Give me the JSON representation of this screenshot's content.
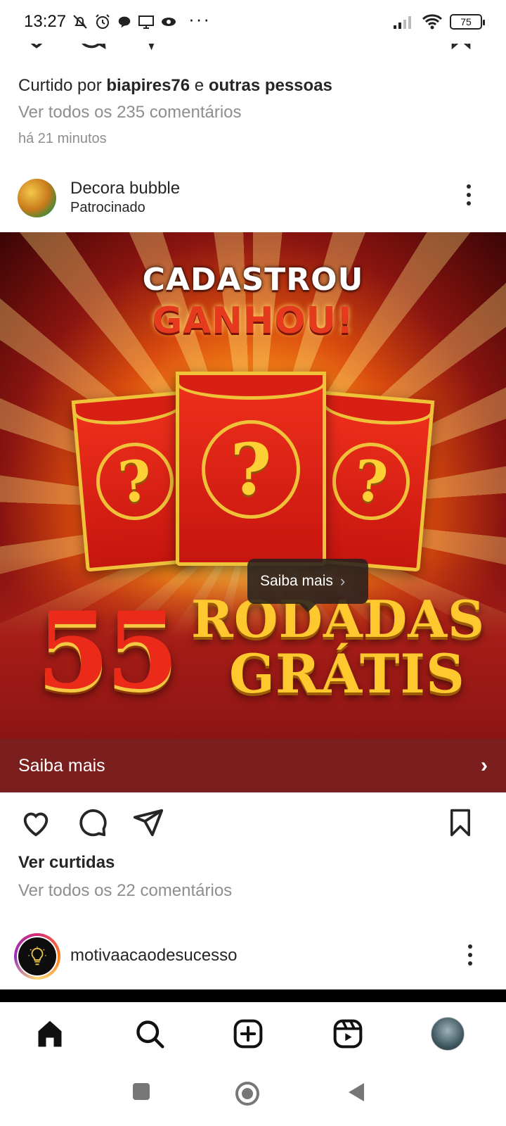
{
  "status_bar": {
    "time": "13:27",
    "more": "···",
    "battery": "75"
  },
  "previous_post": {
    "likes_prefix": "Curtido por ",
    "likes_user": "biapires76",
    "likes_mid": " e ",
    "likes_others": "outras pessoas",
    "comments_link": "Ver todos os 235 comentários",
    "time_ago": "há 21 minutos"
  },
  "sponsored_post": {
    "username": "Decora bubble",
    "sponsored_label": "Patrocinado",
    "ad": {
      "headline_line1": "CADASTROU",
      "headline_line2": "GANHOU!",
      "number": "55",
      "word1": "RODADAS",
      "word2": "GRÁTIS",
      "question_mark": "?",
      "tooltip_label": "Saiba mais",
      "tooltip_chevron": "›"
    },
    "cta_label": "Saiba mais",
    "cta_chevron": "›",
    "view_likes": "Ver curtidas",
    "comments_link": "Ver todos os 22 comentários"
  },
  "next_post": {
    "username": "motivaacaodesucesso"
  },
  "colors": {
    "cta_bar": "#7a1f1d",
    "secondary_text": "#8e8e8e",
    "primary_text": "#262626"
  },
  "icons": {
    "nav": [
      "home-icon",
      "search-icon",
      "create-icon",
      "reels-icon",
      "profile-avatar"
    ],
    "post_actions": [
      "heart-icon",
      "comment-icon",
      "share-icon",
      "bookmark-icon"
    ],
    "system": [
      "recents-icon",
      "home-circle-icon",
      "back-icon"
    ]
  }
}
